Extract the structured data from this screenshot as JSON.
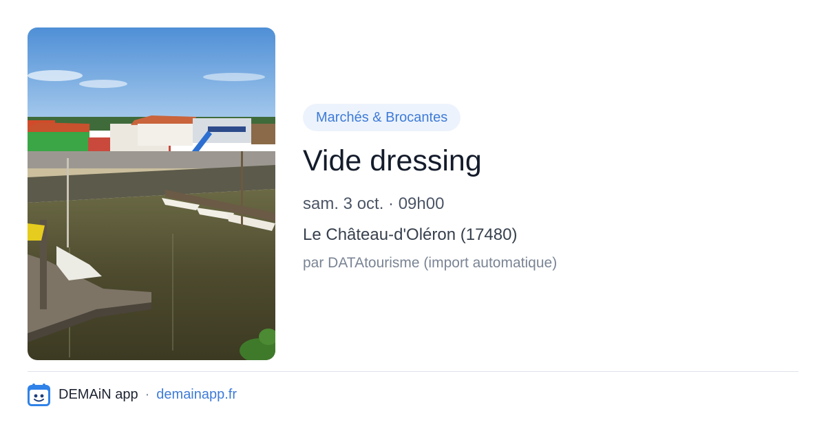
{
  "event": {
    "image_alt": "Port ostréicole avec bateaux et cabanes colorées",
    "category": "Marchés & Brocantes",
    "title": "Vide dressing",
    "datetime": "sam. 3 oct. · 09h00",
    "location": "Le Château-d'Oléron (17480)",
    "author": "par DATAtourisme (import automatique)"
  },
  "footer": {
    "app_icon": "demain-app-icon",
    "app_name": "DEMAiN app",
    "separator": "·",
    "app_link": "demainapp.fr"
  },
  "colors": {
    "accent": "#3d7bd8",
    "category_bg": "#edf3fc",
    "title": "#141c2b",
    "muted": "#7a8494",
    "divider": "#dde2e8"
  }
}
